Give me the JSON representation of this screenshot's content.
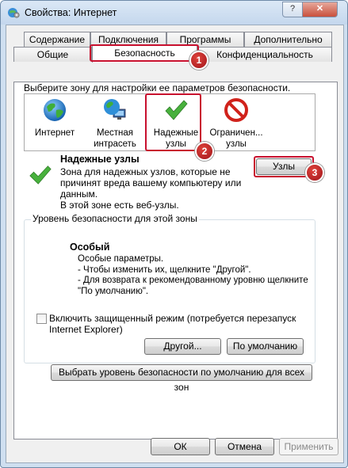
{
  "window": {
    "title": "Свойства: Интернет",
    "help_label": "?",
    "close_label": "✕"
  },
  "tabs": {
    "row1": [
      "Содержание",
      "Подключения",
      "Программы",
      "Дополнительно"
    ],
    "row2": [
      "Общие",
      "Безопасность",
      "Конфиденциальность"
    ],
    "active": "Безопасность"
  },
  "security": {
    "zone_prompt": "Выберите зону для настройки ее параметров безопасности.",
    "zones": [
      {
        "line1": "Интернет",
        "line2": "",
        "icon": "globe-icon"
      },
      {
        "line1": "Местная",
        "line2": "интрасеть",
        "icon": "network-globe-icon"
      },
      {
        "line1": "Надежные",
        "line2": "узлы",
        "icon": "checkmark-icon"
      },
      {
        "line1": "Ограничен...",
        "line2": "узлы",
        "icon": "no-entry-icon"
      }
    ],
    "selected_zone_title": "Надежные узлы",
    "selected_zone_desc": [
      "Зона для надежных узлов, которые не",
      "причинят вреда вашему компьютеру или",
      "данным."
    ],
    "selected_zone_note": "В этой зоне есть веб-узлы.",
    "sites_button": "Узлы",
    "level_group_label": "Уровень безопасности для этой зоны",
    "level_title": "Особый",
    "level_lines": [
      "Особые параметры.",
      "- Чтобы изменить их, щелкните \"Другой\".",
      "- Для возврата к рекомендованному уровню щелкните",
      "\"По умолчанию\"."
    ],
    "protected_mode_label_1": "Включить защищенный режим (потребуется перезапуск",
    "protected_mode_label_2": "Internet Explorer)",
    "protected_mode_checked": false,
    "custom_level_button": "Другой...",
    "default_level_button": "По умолчанию",
    "reset_all_button": "Выбрать уровень безопасности по умолчанию для всех зон"
  },
  "annotations": {
    "badge1": "1",
    "badge2": "2",
    "badge3": "3",
    "color": "#c8102e"
  },
  "footer": {
    "ok": "ОК",
    "cancel": "Отмена",
    "apply": "Применить"
  }
}
